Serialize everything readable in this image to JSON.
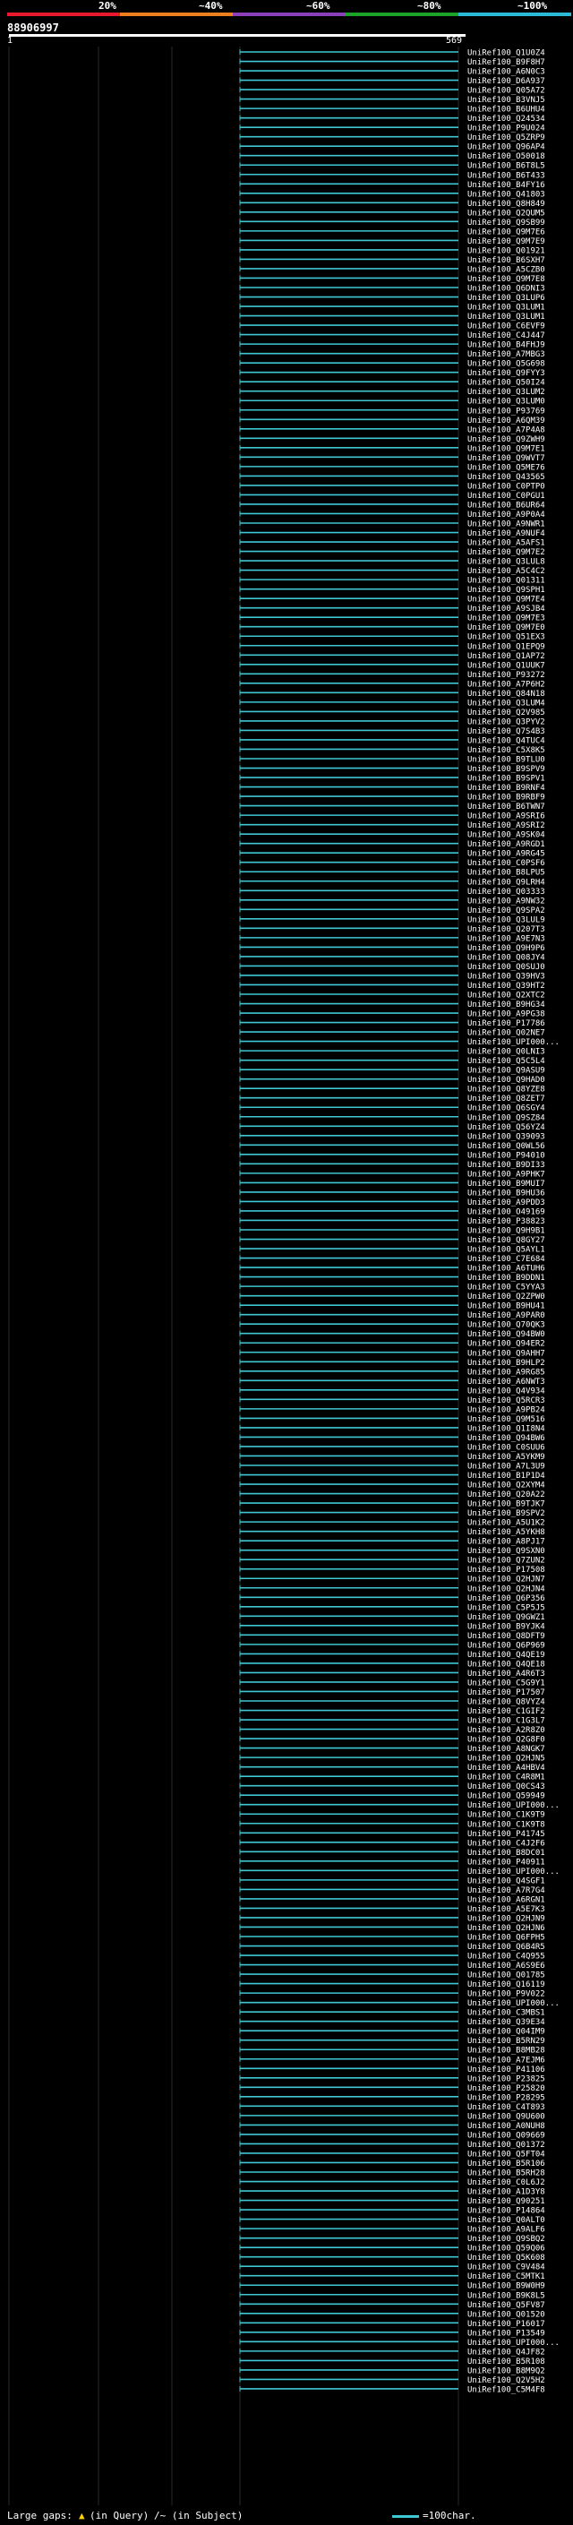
{
  "header": {
    "query_id": "88906997",
    "ruler_start": "1",
    "ruler_end": "569",
    "percent_labels": [
      "20%",
      "~40%",
      "~60%",
      "~80%",
      "~100%"
    ],
    "colorbar": [
      {
        "color": "#e8192c"
      },
      {
        "color": "#f07f1e"
      },
      {
        "color": "#8b3fb8"
      },
      {
        "color": "#1ea32a"
      },
      {
        "color": "#2bbbd6"
      }
    ]
  },
  "footer": {
    "large_gaps_label": "Large gaps:",
    "query_gap_label": "(in Query)",
    "subject_gap_label": "/~ (in Subject)",
    "scale_label": "=100char."
  },
  "chart_data": {
    "type": "alignment-overview",
    "query_length": 569,
    "hit_color": "#3fc7d4",
    "row_spacing": 10.52,
    "labels": [
      "UniRef100_Q1U0Z4",
      "UniRef100_B9F8H7",
      "UniRef100_A6N0C3",
      "UniRef100_D6A937",
      "UniRef100_Q05A72",
      "UniRef100_B3VNJ5",
      "UniRef100_B6UHU4",
      "UniRef100_Q24534",
      "UniRef100_P9U024",
      "UniRef100_Q5ZRP9",
      "UniRef100_Q96AP4",
      "UniRef100_O50018",
      "UniRef100_B6T8L5",
      "UniRef100_B6T433",
      "UniRef100_B4FY16",
      "UniRef100_Q41803",
      "UniRef100_Q8H849",
      "UniRef100_Q2QUM5",
      "UniRef100_Q9SB99",
      "UniRef100_Q9M7E6",
      "UniRef100_Q9M7E9",
      "UniRef100_Q01921",
      "UniRef100_B6SXH7",
      "UniRef100_A5CZB0",
      "UniRef100_Q9M7E8",
      "UniRef100_Q6DNI3",
      "UniRef100_Q3LUP6",
      "UniRef100_Q3LUM1",
      "UniRef100_Q3LUM1",
      "UniRef100_C6EVF9",
      "UniRef100_C4J447",
      "UniRef100_B4FHJ9",
      "UniRef100_A7MBG3",
      "UniRef100_Q5G698",
      "UniRef100_Q9FYY3",
      "UniRef100_Q50I24",
      "UniRef100_Q3LUM2",
      "UniRef100_Q3LUM0",
      "UniRef100_P93769",
      "UniRef100_A6QM39",
      "UniRef100_A7P4A8",
      "UniRef100_Q9ZWH9",
      "UniRef100_Q9M7E1",
      "UniRef100_Q9WVT7",
      "UniRef100_Q5ME76",
      "UniRef100_Q43565",
      "UniRef100_C0PTP0",
      "UniRef100_C0PGU1",
      "UniRef100_B6UR64",
      "UniRef100_A9P0A4",
      "UniRef100_A9NWR1",
      "UniRef100_A9NUF4",
      "UniRef100_A5AFS1",
      "UniRef100_Q9M7E2",
      "UniRef100_Q3LUL8",
      "UniRef100_A5C4C2",
      "UniRef100_Q01311",
      "UniRef100_Q9SPH1",
      "UniRef100_Q9M7E4",
      "UniRef100_A9SJB4",
      "UniRef100_Q9M7E3",
      "UniRef100_Q9M7E0",
      "UniRef100_Q51EX3",
      "UniRef100_Q1EPQ9",
      "UniRef100_Q1AP72",
      "UniRef100_Q1UUK7",
      "UniRef100_P93272",
      "UniRef100_A7P6H2",
      "UniRef100_Q84N18",
      "UniRef100_Q3LUM4",
      "UniRef100_Q2V985",
      "UniRef100_Q3PYV2",
      "UniRef100_Q7S4B3",
      "UniRef100_Q4TUC4",
      "UniRef100_C5X8K5",
      "UniRef100_B9TLU0",
      "UniRef100_B9SPV9",
      "UniRef100_B9SPV1",
      "UniRef100_B9RNF4",
      "UniRef100_B9RBF9",
      "UniRef100_B6TWN7",
      "UniRef100_A9SRI6",
      "UniRef100_A9SRI2",
      "UniRef100_A9SK04",
      "UniRef100_A9RGD1",
      "UniRef100_A9RG45",
      "UniRef100_C0PSF6",
      "UniRef100_B8LPU5",
      "UniRef100_Q9LRH4",
      "UniRef100_Q03333",
      "UniRef100_A9NW32",
      "UniRef100_Q9SPA2",
      "UniRef100_Q3LUL9",
      "UniRef100_Q207T3",
      "UniRef100_A9E7N3",
      "UniRef100_Q9H9P6",
      "UniRef100_Q08JY4",
      "UniRef100_Q0SUJ0",
      "UniRef100_Q39HV3",
      "UniRef100_Q39HT2",
      "UniRef100_Q2XTC2",
      "UniRef100_B9HG34",
      "UniRef100_A9PG38",
      "UniRef100_P17786",
      "UniRef100_Q02NE7",
      "UniRef100_UPI000...",
      "UniRef100_Q0LNI3",
      "UniRef100_Q5C5L4",
      "UniRef100_Q9ASU9",
      "UniRef100_Q9HAD0",
      "UniRef100_Q8YZE8",
      "UniRef100_Q8ZET7",
      "UniRef100_Q6SGY4",
      "UniRef100_Q9SZ84",
      "UniRef100_Q56YZ4",
      "UniRef100_Q39093",
      "UniRef100_Q0WL56",
      "UniRef100_P94010",
      "UniRef100_B9DI33",
      "UniRef100_A9PHK7",
      "UniRef100_B9MUI7",
      "UniRef100_B9HU36",
      "UniRef100_A9PDD3",
      "UniRef100_O49169",
      "UniRef100_P38823",
      "UniRef100_Q9H9B1",
      "UniRef100_Q8GY27",
      "UniRef100_Q5AYL1",
      "UniRef100_C7E684",
      "UniRef100_A6TUH6",
      "UniRef100_B9DDN1",
      "UniRef100_C5YYA3",
      "UniRef100_Q2ZPW0",
      "UniRef100_B9HU41",
      "UniRef100_A9PAR0",
      "UniRef100_Q70QK3",
      "UniRef100_Q94BW0",
      "UniRef100_Q94ER2",
      "UniRef100_Q9AHH7",
      "UniRef100_B9HLP2",
      "UniRef100_A9RG85",
      "UniRef100_A6NWT3",
      "UniRef100_Q4V934",
      "UniRef100_Q5RCR3",
      "UniRef100_A9PB24",
      "UniRef100_Q9M516",
      "UniRef100_Q1I8N4",
      "UniRef100_Q94BW6",
      "UniRef100_C0SUU6",
      "UniRef100_A5YKM9",
      "UniRef100_A7L3U9",
      "UniRef100_B1P1D4",
      "UniRef100_Q2XYM4",
      "UniRef100_Q20A22",
      "UniRef100_B9TJK7",
      "UniRef100_B9SPV2",
      "UniRef100_A5U1K2",
      "UniRef100_A5YKH8",
      "UniRef100_A8PJ17",
      "UniRef100_Q9SXN0",
      "UniRef100_Q7ZUN2",
      "UniRef100_P17508",
      "UniRef100_Q2HJN7",
      "UniRef100_Q2HJN4",
      "UniRef100_Q6P356",
      "UniRef100_C5P5J5",
      "UniRef100_Q9GWZ1",
      "UniRef100_B9YJK4",
      "UniRef100_Q8DFT9",
      "UniRef100_Q6P969",
      "UniRef100_Q4QE19",
      "UniRef100_Q4QE18",
      "UniRef100_A4R6T3",
      "UniRef100_C5G9Y1",
      "UniRef100_P17507",
      "UniRef100_Q8VYZ4",
      "UniRef100_C1GIF2",
      "UniRef100_C1G3L7",
      "UniRef100_A2R8Z0",
      "UniRef100_Q2G8F0",
      "UniRef100_A8NGK7",
      "UniRef100_Q2HJN5",
      "UniRef100_A4HBV4",
      "UniRef100_C4R8M1",
      "UniRef100_Q0CS43",
      "UniRef100_Q59949",
      "UniRef100_UPI000...",
      "UniRef100_C1K9T9",
      "UniRef100_C1K9T8",
      "UniRef100_P41745",
      "UniRef100_C4J2F6",
      "UniRef100_B8DC01",
      "UniRef100_P40911",
      "UniRef100_UPI000...",
      "UniRef100_Q4SGF1",
      "UniRef100_A7R7G4",
      "UniRef100_A6RGN1",
      "UniRef100_A5E7K3",
      "UniRef100_Q2HJN9",
      "UniRef100_Q2HJN6",
      "UniRef100_Q6FPH5",
      "UniRef100_Q6B4R5",
      "UniRef100_C4Q955",
      "UniRef100_A6S9E6",
      "UniRef100_Q01785",
      "UniRef100_Q16119",
      "UniRef100_P9V022",
      "UniRef100_UPI000...",
      "UniRef100_C3MBS1",
      "UniRef100_Q39E34",
      "UniRef100_Q04IM9",
      "UniRef100_B5RN29",
      "UniRef100_B8MB28",
      "UniRef100_A7EJM6",
      "UniRef100_P41106",
      "UniRef100_P23825",
      "UniRef100_P25820",
      "UniRef100_P28295",
      "UniRef100_C4T893",
      "UniRef100_Q9U600",
      "UniRef100_A0NUH8",
      "UniRef100_Q09669",
      "UniRef100_Q01372",
      "UniRef100_Q5FT04",
      "UniRef100_B5R106",
      "UniRef100_B5RH28",
      "UniRef100_C0L6J2",
      "UniRef100_A1D3Y8",
      "UniRef100_Q90251",
      "UniRef100_P14864",
      "UniRef100_Q0ALT0",
      "UniRef100_A9ALF6",
      "UniRef100_Q9SBQ2",
      "UniRef100_Q59Q06",
      "UniRef100_Q5K608",
      "UniRef100_C9V484",
      "UniRef100_C5MTK1",
      "UniRef100_B9W0H9",
      "UniRef100_B9K8L5",
      "UniRef100_Q5FV87",
      "UniRef100_Q01520",
      "UniRef100_P16017",
      "UniRef100_P13549",
      "UniRef100_UPI000...",
      "UniRef100_Q4JF82",
      "UniRef100_B5R108",
      "UniRef100_B8M9Q2",
      "UniRef100_Q2V5H2",
      "UniRef100_C5M4F8"
    ]
  }
}
